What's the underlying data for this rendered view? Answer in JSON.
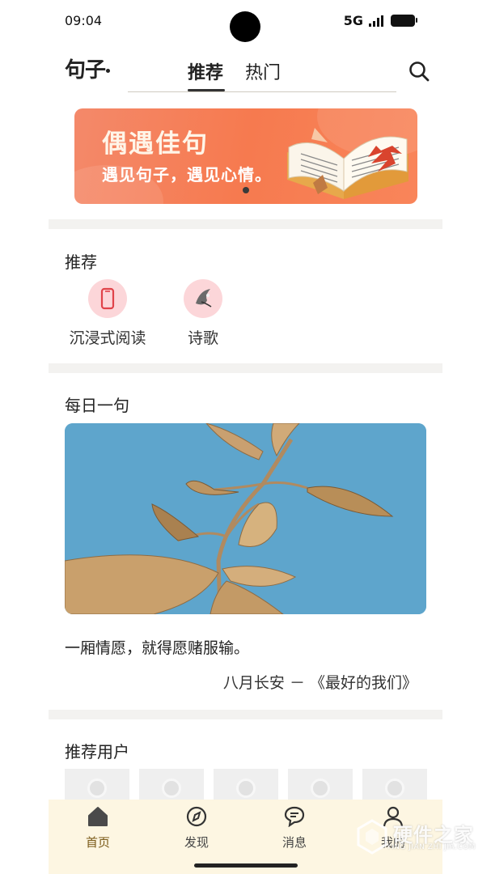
{
  "status_bar": {
    "time": "09:04",
    "network": "5G"
  },
  "header": {
    "logo": "句子",
    "tabs": [
      {
        "label": "推荐",
        "active": true
      },
      {
        "label": "热门",
        "active": false
      }
    ],
    "search_icon": "search-icon"
  },
  "banner": {
    "title": "偶遇佳句",
    "subtitle": "遇见句子，遇见心情。",
    "page_indicator": {
      "current": 1
    }
  },
  "recommend": {
    "title": "推荐",
    "items": [
      {
        "label": "沉浸式阅读",
        "icon": "phone-icon"
      },
      {
        "label": "诗歌",
        "icon": "poetry-icon"
      }
    ]
  },
  "daily": {
    "title": "每日一句",
    "quote": "一厢情愿，就得愿赌服输。",
    "source": "八月长安 － 《最好的我们》"
  },
  "users": {
    "title": "推荐用户",
    "count": 5
  },
  "bottom_nav": {
    "items": [
      {
        "label": "首页",
        "icon": "home-icon",
        "active": true
      },
      {
        "label": "发现",
        "icon": "compass-icon",
        "active": false
      },
      {
        "label": "消息",
        "icon": "message-icon",
        "active": false
      },
      {
        "label": "我的",
        "icon": "user-icon",
        "active": false
      }
    ]
  },
  "watermark": {
    "text": "硬件之家",
    "sub": "YING JIAN ZHI JIA.COM"
  },
  "colors": {
    "banner": "#f67a4f",
    "nav_background": "#fdf6e2",
    "rec_icon_bg": "#fcd6d9",
    "sky": "#5ea5cc",
    "leaf": "#c9a070"
  }
}
